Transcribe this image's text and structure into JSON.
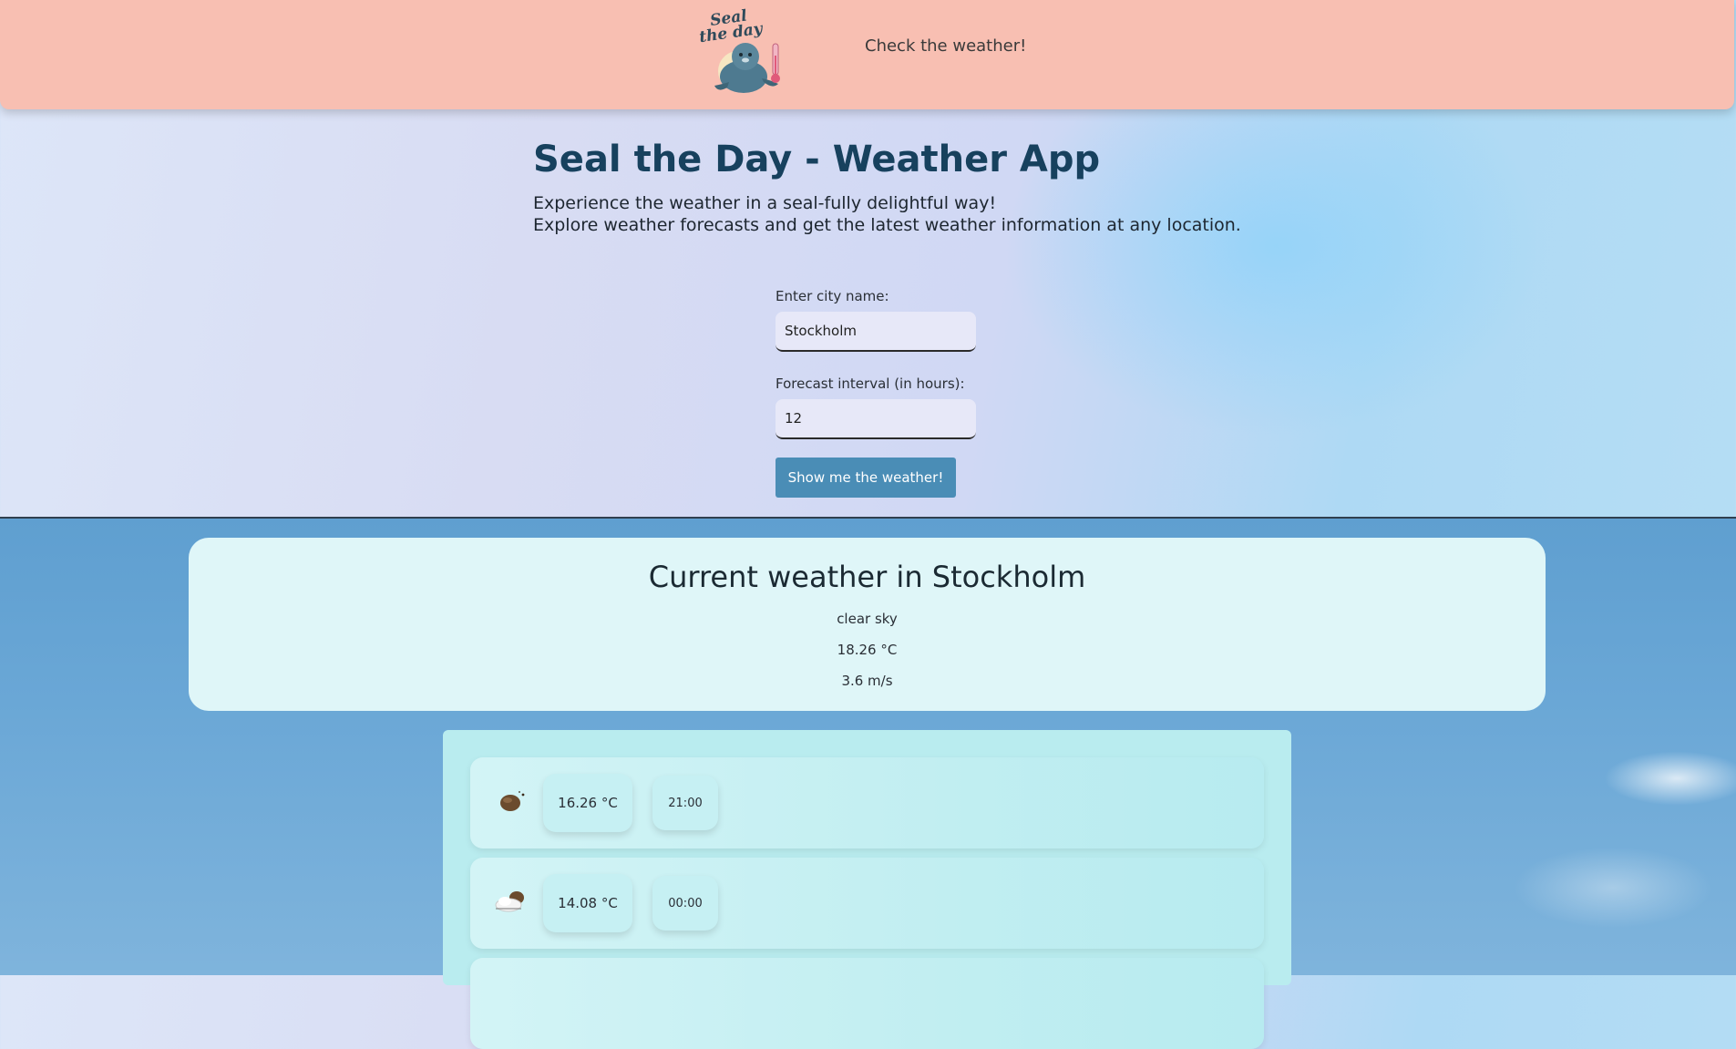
{
  "header": {
    "logo_alt": "Seal the day",
    "tagline": "Check the weather!"
  },
  "hero": {
    "title": "Seal the Day - Weather App",
    "subtitle_line1": "Experience the weather in a seal-fully delightful way!",
    "subtitle_line2": "Explore weather forecasts and get the latest weather information at any location."
  },
  "form": {
    "city_label": "Enter city name:",
    "city_value": "Stockholm",
    "interval_label": "Forecast interval (in hours):",
    "interval_value": "12",
    "submit_label": "Show me the weather!"
  },
  "current": {
    "title": "Current weather in Stockholm",
    "description": "clear sky",
    "temperature": "18.26 °C",
    "wind": "3.6 m/s"
  },
  "forecast": [
    {
      "icon": "clear-night-icon",
      "temperature": "16.26 °C",
      "time": "21:00"
    },
    {
      "icon": "cloudy-night-icon",
      "temperature": "14.08 °C",
      "time": "00:00"
    }
  ],
  "colors": {
    "header_bg": "#f8bfb2",
    "title_color": "#17415e",
    "button_bg": "#4a8db6",
    "current_card_bg": "#dff6f8",
    "forecast_panel_bg": "#b9ecef"
  }
}
